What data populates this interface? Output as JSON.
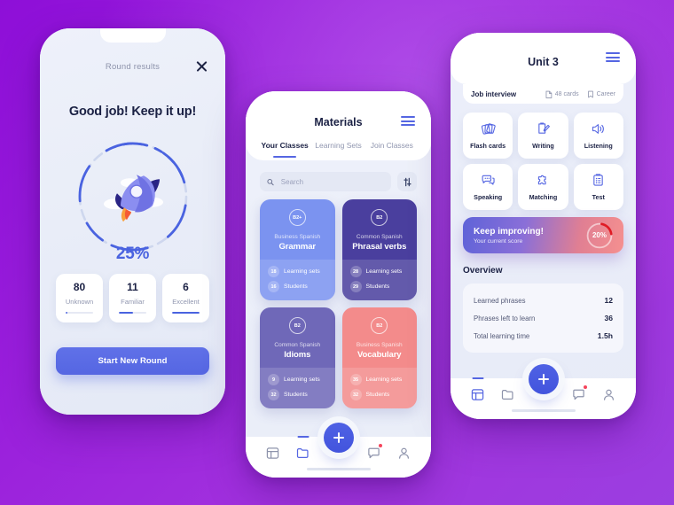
{
  "theme": {
    "bg_purple_start": "#8e0fd8",
    "bg_purple_end": "#9b3ee0",
    "accent_blue": "#5566e2",
    "text_dark": "#1b2144",
    "text_muted": "#9096af",
    "danger_red": "#f5455c"
  },
  "phone1": {
    "header_title": "Round results",
    "close_icon": "close-icon",
    "headline": "Good job! Keep it up!",
    "progress": {
      "percent_label": "25%",
      "percent_value": 25,
      "ring_color": "#4a63e0",
      "track_color": "#c9d2ec"
    },
    "illustration": "rocket-illustration",
    "stats": [
      {
        "value": "80",
        "label": "Unknown",
        "fill": 6
      },
      {
        "value": "11",
        "label": "Familiar",
        "fill": 52
      },
      {
        "value": "6",
        "label": "Excellent",
        "fill": 100
      }
    ],
    "cta_label": "Start New Round",
    "nav": {
      "items": [
        {
          "icon": "dashboard-icon",
          "active": false,
          "badge": false
        },
        {
          "icon": "folder-icon",
          "active": false,
          "badge": false
        },
        {
          "icon": "chat-icon",
          "active": false,
          "badge": true
        },
        {
          "icon": "profile-icon",
          "active": false,
          "badge": false
        }
      ],
      "fab_icon": "plus-icon"
    }
  },
  "phone2": {
    "header_title": "Materials",
    "menu_icon": "hamburger-menu-icon",
    "tabs": [
      {
        "label": "Your Classes",
        "active": true
      },
      {
        "label": "Learning Sets",
        "active": false
      },
      {
        "label": "Join Classes",
        "active": false
      }
    ],
    "search": {
      "placeholder": "Search",
      "value": "",
      "icon": "search-icon",
      "filter_icon": "filter-sliders-icon"
    },
    "class_cards": [
      {
        "level": "B2+",
        "subtitle": "Business Spanish",
        "title": "Grammar",
        "sets_count": "18",
        "sets_label": "Learning sets",
        "students_count": "16",
        "students_label": "Students",
        "color": "#7b93f0"
      },
      {
        "level": "B2",
        "subtitle": "Common Spanish",
        "title": "Phrasal verbs",
        "sets_count": "28",
        "sets_label": "Learning sets",
        "students_count": "29",
        "students_label": "Students",
        "color": "#4a3f9e"
      },
      {
        "level": "B2",
        "subtitle": "Common Spanish",
        "title": "Idioms",
        "sets_count": "9",
        "sets_label": "Learning sets",
        "students_count": "32",
        "students_label": "Students",
        "color": "#6f68b8"
      },
      {
        "level": "B2",
        "subtitle": "Business Spanish",
        "title": "Vocabulary",
        "sets_count": "35",
        "sets_label": "Learning sets",
        "students_count": "32",
        "students_label": "Students",
        "color": "#f38b8b"
      }
    ],
    "nav": {
      "items": [
        {
          "icon": "dashboard-icon",
          "active": false,
          "badge": false
        },
        {
          "icon": "folder-icon",
          "active": true,
          "badge": false
        },
        {
          "icon": "chat-icon",
          "active": false,
          "badge": true
        },
        {
          "icon": "profile-icon",
          "active": false,
          "badge": false
        }
      ],
      "fab_icon": "plus-icon"
    }
  },
  "phone3": {
    "header_title": "Unit 3",
    "menu_icon": "hamburger-menu-icon",
    "subheader": {
      "name": "Job interview",
      "cards_count": "48 cards",
      "cards_icon": "file-icon",
      "category": "Career",
      "category_icon": "bookmark-icon"
    },
    "activities": [
      {
        "label": "Flash cards",
        "icon": "flash-cards-icon"
      },
      {
        "label": "Writing",
        "icon": "writing-icon"
      },
      {
        "label": "Listening",
        "icon": "speaker-icon"
      },
      {
        "label": "Speaking",
        "icon": "speech-bubbles-icon"
      },
      {
        "label": "Matching",
        "icon": "puzzle-icon"
      },
      {
        "label": "Test",
        "icon": "clipboard-icon"
      }
    ],
    "banner": {
      "title": "Keep improving!",
      "subtitle": "Your current score",
      "percent_label": "20%",
      "percent_value": 20,
      "ring_color": "#e01b24"
    },
    "overview_title": "Overview",
    "overview_rows": [
      {
        "label": "Learned phrases",
        "value": "12"
      },
      {
        "label": "Phrases left to learn",
        "value": "36"
      },
      {
        "label": "Total learning time",
        "value": "1.5h"
      }
    ],
    "nav": {
      "items": [
        {
          "icon": "dashboard-icon",
          "active": true,
          "badge": false
        },
        {
          "icon": "folder-icon",
          "active": false,
          "badge": false
        },
        {
          "icon": "chat-icon",
          "active": false,
          "badge": true
        },
        {
          "icon": "profile-icon",
          "active": false,
          "badge": false
        }
      ],
      "fab_icon": "plus-icon"
    }
  }
}
